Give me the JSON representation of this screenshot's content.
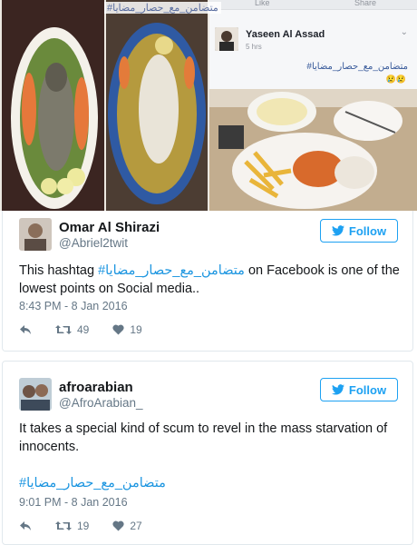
{
  "photo_collage": {
    "overlay_hashtag": "#متضامن_مع_حصار_مضايا",
    "facebook_post": {
      "topbar_like": "Like",
      "topbar_share": "Share",
      "author": "Yaseen Al Assad",
      "time": "5 hrs",
      "hashtag": "#متضامن_مع_حصار_مضايا",
      "emoji": "😢😢"
    }
  },
  "tweets": [
    {
      "display_name": "Omar Al Shirazi",
      "handle": "@Abriel2twit",
      "follow_label": "Follow",
      "text_before": "This hashtag ",
      "hashtag": "#متضامن_مع_حصار_مضايا",
      "text_after": " on Facebook is one of the lowest points on Social media..",
      "timestamp": "8:43 PM - 8 Jan 2016",
      "retweets": "49",
      "likes": "19"
    },
    {
      "display_name": "afroarabian",
      "handle": "@AfroArabian_",
      "follow_label": "Follow",
      "text": "It takes a special kind of scum to revel in the mass starvation of innocents.",
      "hashtag": "#متضامن_مع_حصار_مضايا",
      "timestamp": "9:01 PM - 8 Jan 2016",
      "retweets": "19",
      "likes": "27"
    }
  ],
  "colors": {
    "twitter_blue": "#1da1f2",
    "hashtag_blue": "#1b95e0",
    "muted_text": "#657786"
  }
}
